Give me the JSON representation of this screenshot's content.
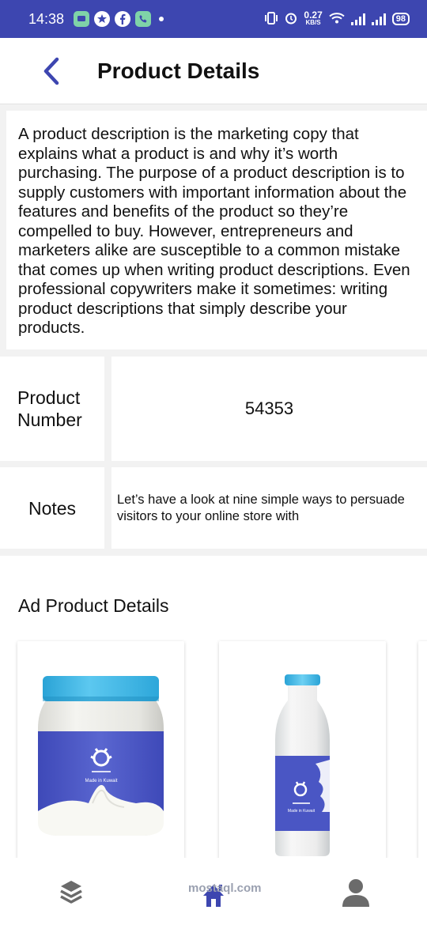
{
  "status_bar": {
    "time": "14:38",
    "speed_value": "0.27",
    "speed_unit": "KB/S",
    "battery": "98",
    "icons": [
      "message-icon",
      "settings-icon",
      "facebook-icon",
      "phone-icon",
      "vibrate-icon",
      "alarm-icon",
      "wifi-icon",
      "signal-icon",
      "signal-icon",
      "battery-icon"
    ]
  },
  "header": {
    "back_icon": "chevron-left-icon",
    "title": "Product Details"
  },
  "description": "A product description is the marketing copy that explains what a product is and why it’s worth purchasing. The purpose of a product description is to supply customers with important information about the features and benefits of the product so they’re compelled to buy.  However, entrepreneurs and marketers alike are susceptible to a common mistake that comes up when writing product descriptions. Even professional copywriters make it sometimes: writing product descriptions that simply describe your products.",
  "details": [
    {
      "label": "Product Number",
      "value": "54353"
    },
    {
      "label": "Notes",
      "value": "Let’s have a look at nine simple ways to persuade visitors to your online store with"
    }
  ],
  "ad_section": {
    "title": "Ad Product Details",
    "products": [
      {
        "image": "cream-jar-image",
        "brand_text": "Made in Kuwait"
      },
      {
        "image": "milk-bottle-image",
        "brand_text": "Made in Kuwait"
      }
    ]
  },
  "bottom_nav": {
    "items": [
      "layers-icon",
      "home-icon",
      "profile-icon"
    ],
    "watermark": "mostaql.com"
  },
  "colors": {
    "primary": "#3d46b0",
    "lid_blue": "#3fb8e8",
    "label_blue": "#4a56c4",
    "icon_gray": "#6b6b6b"
  }
}
